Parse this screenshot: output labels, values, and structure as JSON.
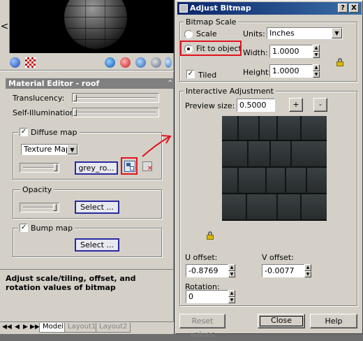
{
  "material_editor": {
    "title": "Material Editor - roof",
    "translucency_label": "Translucency:",
    "self_illumination_label": "Self-Illumination:",
    "translucency_value": 0.0,
    "self_illumination_value": 0.0,
    "diffuse": {
      "label": "Diffuse map",
      "checked": true,
      "map_type": "Texture Map",
      "slider_value": 1.0,
      "file_button": "grey_ro..."
    },
    "opacity": {
      "label": "Opacity",
      "select_button": "Select ..."
    },
    "bump": {
      "label": "Bump map",
      "checked": true,
      "select_button": "Select ..."
    },
    "hint": "Adjust scale/tiling, offset, and rotation values of bitmap",
    "tabs": [
      "Model",
      "Layout1",
      "Layout2"
    ],
    "active_tab": "Model",
    "preview_nav": "<"
  },
  "annotation_color": "#e0141e",
  "dialog": {
    "title": "Adjust Bitmap",
    "help_btn": "?",
    "close_btn": "X",
    "bitmap_scale": {
      "label": "Bitmap Scale",
      "scale_label": "Scale",
      "fit_label": "Fit to object",
      "selected": "Fit to object",
      "units_label": "Units:",
      "units_value": "Inches",
      "width_label": "Width:",
      "width_value": "1.0000",
      "height_label": "Height:",
      "height_value": "1.0000",
      "tiled_label": "Tiled",
      "tiled_checked": true
    },
    "interactive": {
      "label": "Interactive Adjustment",
      "preview_size_label": "Preview size:",
      "preview_size_value": "0.5000",
      "plus": "+",
      "minus": "-"
    },
    "u_offset_label": "U offset:",
    "u_offset_value": "-0.8769",
    "v_offset_label": "V offset:",
    "v_offset_value": "-0.0077",
    "rotation_label": "Rotation:",
    "rotation_value": "0",
    "buttons": {
      "reset": "Reset values",
      "close": "Close",
      "help": "Help"
    }
  }
}
